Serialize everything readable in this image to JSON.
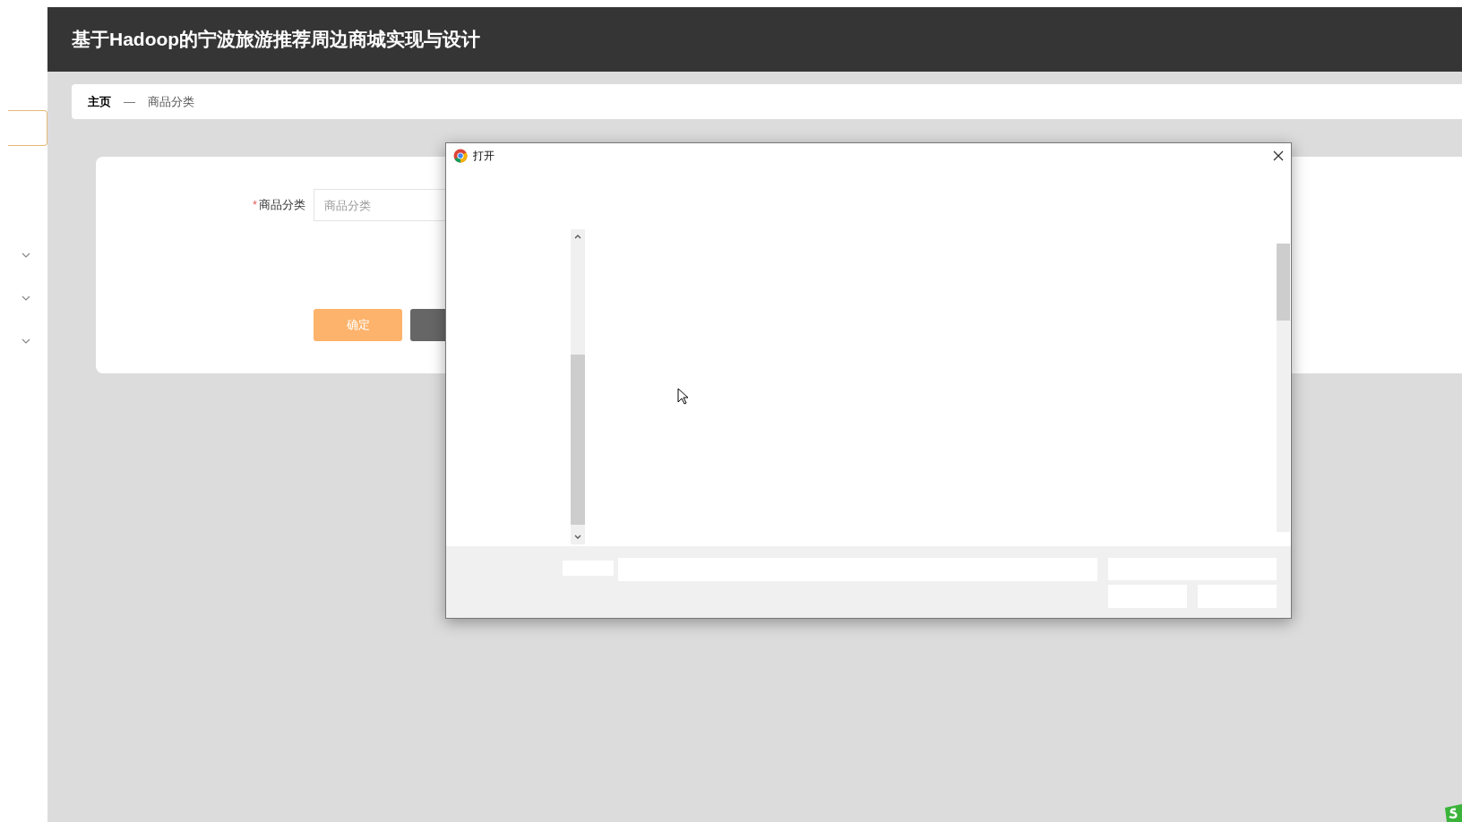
{
  "header": {
    "title": "基于Hadoop的宁波旅游推荐周边商城实现与设计"
  },
  "breadcrumb": {
    "items": [
      {
        "label": "主页",
        "current": false
      },
      {
        "label": "商品分类",
        "current": true
      }
    ],
    "separator": "—"
  },
  "form": {
    "fields": [
      {
        "label": "商品分类",
        "required_mark": "*",
        "placeholder": "商品分类"
      }
    ],
    "buttons": [
      {
        "label": "确定",
        "kind": "primary"
      },
      {
        "kind": "secondary"
      }
    ]
  },
  "dialog": {
    "title": "打开"
  }
}
